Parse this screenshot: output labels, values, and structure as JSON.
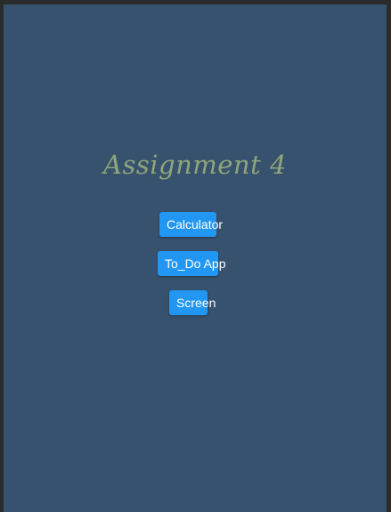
{
  "app": {
    "title": "Assignment 4"
  },
  "buttons": {
    "calculator": "Calculator",
    "todo": "To_Do App",
    "screen": "Screen"
  },
  "colors": {
    "background": "#37526e",
    "title": "#8fa57a",
    "button": "#2196f3",
    "button_text": "#ffffff"
  }
}
